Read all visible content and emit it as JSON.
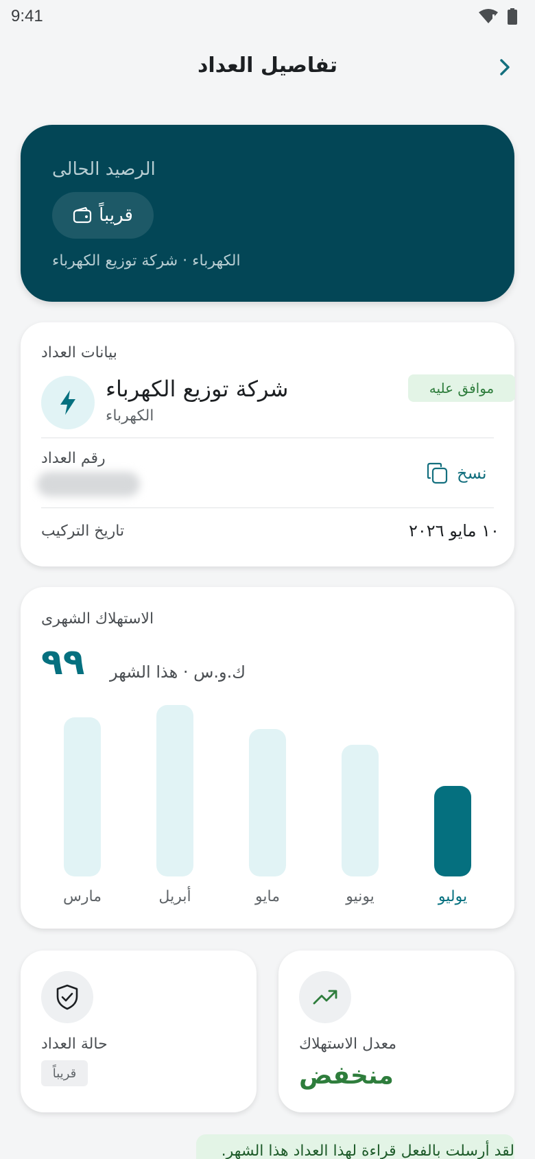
{
  "status_bar": {
    "time": "9:41",
    "wifi_icon": "wifi-icon",
    "battery_icon": "battery-icon"
  },
  "app_bar": {
    "title": "تفاصيل العداد",
    "back_icon": "chevron-right-icon"
  },
  "balance": {
    "label": "الرصيد الحالى",
    "value": "قريباً",
    "subtitle": "الكهرباء · شركة توزيع الكهرباء"
  },
  "meter_info": {
    "heading": "بيانات العداد",
    "status_badge": "موافق عليه",
    "provider_name": "شركة توزيع الكهرباء",
    "provider_type": "الكهرباء",
    "number_label": "رقم العداد",
    "copy_label": "نسخ",
    "install_label": "تاريخ التركيب",
    "install_date": "١٠ مايو ٢٠٢٦"
  },
  "usage": {
    "heading": "الاستهلاك الشهرى",
    "current_value": "٩٩",
    "unit_text": "ك.و.س · هذا الشهر"
  },
  "chart_data": {
    "type": "bar",
    "categories": [
      "مارس",
      "أبريل",
      "مايو",
      "يونيو",
      "يوليو"
    ],
    "values": [
      0.93,
      1.0,
      0.86,
      0.77,
      0.53
    ],
    "highlight": "يوليو",
    "colors": {
      "bar": "#e1f3f5",
      "highlight": "#05707f"
    }
  },
  "meter_status": {
    "label": "حالة العداد",
    "badge": "قريباً",
    "icon": "shield-check-icon"
  },
  "consumption_rate": {
    "label": "معدل الاستهلاك",
    "value": "منخفض",
    "icon": "trending-up-icon"
  },
  "toast": {
    "message": "لقد أرسلت بالفعل قراءة لهذا العداد هذا الشهر."
  },
  "colors": {
    "primary": "#034656",
    "accent": "#05707f",
    "success": "#2e7d3c"
  }
}
